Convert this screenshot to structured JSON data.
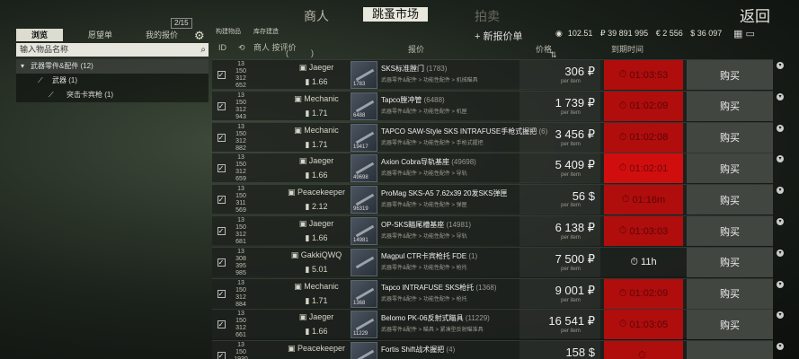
{
  "topnav": {
    "trader": "商人",
    "flea": "跳蚤市场",
    "auction": "拍卖",
    "back": "返回"
  },
  "left": {
    "tabs": {
      "browse": "浏览",
      "watch": "愿望单",
      "offers": "我的报价"
    },
    "offers_count": "2/15",
    "search_placeholder": "输入物品名称",
    "tree": [
      {
        "label": "武器零件&配件 (12)"
      },
      {
        "label": "武器 (1)"
      },
      {
        "label": "突击卡宾枪 (1)"
      }
    ]
  },
  "header": {
    "build": "构建物品",
    "stock": "库存建造",
    "seller_rating": "商人 按评价",
    "col_id": "ID",
    "col_item": "报价",
    "col_price": "价格",
    "col_expire": "到期时间",
    "paren_open": "(",
    "paren_close": ")",
    "add_offer": "+ 新报价单",
    "currencies": {
      "gp": "102.51",
      "rub": "₽ 39 891 995",
      "eur": "€ 2 556",
      "usd": "$ 36 097"
    }
  },
  "listings": [
    {
      "ids": [
        "13",
        "150",
        "312",
        "652"
      ],
      "seller": "Jaeger",
      "rating": "1.66",
      "item_id": "1783",
      "name": "SKS标准膛门",
      "count": "(1783)",
      "cat": "武器零件&配件 > 功能性配件 > 机械瞄具",
      "price": "306 ₽",
      "per": "per item",
      "timer": "01:03:53",
      "timer_style": "red",
      "buy": "购买"
    },
    {
      "ids": [
        "13",
        "150",
        "312",
        "943"
      ],
      "seller": "Mechanic",
      "rating": "1.71",
      "item_id": "6488",
      "name": "Tapco膛冲管",
      "count": "(6488)",
      "cat": "武器零件&配件 > 功能性配件 > 机匣",
      "price": "1 739 ₽",
      "per": "per item",
      "timer": "01:02:09",
      "timer_style": "red",
      "buy": "购买"
    },
    {
      "ids": [
        "13",
        "150",
        "312",
        "882"
      ],
      "seller": "Mechanic",
      "rating": "1.71",
      "item_id": "19417",
      "name": "TAPCO SAW-Style SKS INTRAFUSE手枪式握把",
      "count": "(6)",
      "cat": "武器零件&配件 > 功能性配件 > 手枪式握把",
      "price": "3 456 ₽",
      "per": "per item",
      "timer": "01:02:08",
      "timer_style": "red",
      "buy": "购买"
    },
    {
      "ids": [
        "13",
        "150",
        "312",
        "659"
      ],
      "seller": "Jaeger",
      "rating": "1.66",
      "item_id": "49698",
      "name": "Axion Cobra导轨基座",
      "count": "(49698)",
      "cat": "武器零件&配件 > 功能性配件 > 导轨",
      "price": "5 409 ₽",
      "per": "per item",
      "timer": "01:02:01",
      "timer_style": "red-bright",
      "buy": "购买"
    },
    {
      "ids": [
        "13",
        "150",
        "311",
        "569"
      ],
      "seller": "Peacekeeper",
      "rating": "2.12",
      "item_id": "96319",
      "name": "ProMag SKS-A5 7.62x39 20发SKS弹匣",
      "count": "",
      "cat": "武器零件&配件 > 功能性配件 > 弹匣",
      "price": "56 $",
      "per": "per item",
      "timer": "01:16m",
      "timer_style": "red",
      "buy": "购买"
    },
    {
      "ids": [
        "13",
        "150",
        "312",
        "681"
      ],
      "seller": "Jaeger",
      "rating": "1.66",
      "item_id": "14981",
      "name": "OP-SKS瞄尾槽基座",
      "count": "(14981)",
      "cat": "武器零件&配件 > 功能性配件 > 导轨",
      "price": "6 138 ₽",
      "per": "per item",
      "timer": "01:03:03",
      "timer_style": "red",
      "buy": "购买"
    },
    {
      "ids": [
        "13",
        "308",
        "395",
        "985"
      ],
      "seller": "GakkiQWQ",
      "rating": "5.01",
      "item_id": "",
      "name": "Magpul CTR卡宾枪托 FDE",
      "count": "(1)",
      "cat": "武器零件&配件 > 功能性配件 > 枪托",
      "price": "7 500 ₽",
      "per": "per item",
      "timer": "11h",
      "timer_style": "none",
      "buy": "购买"
    },
    {
      "ids": [
        "13",
        "150",
        "312",
        "884"
      ],
      "seller": "Mechanic",
      "rating": "1.71",
      "item_id": "1368",
      "name": "Tapco INTRAFUSE SKS枪托",
      "count": "(1368)",
      "cat": "武器零件&配件 > 功能性配件 > 枪托",
      "price": "9 001 ₽",
      "per": "per item",
      "timer": "01:02:09",
      "timer_style": "red",
      "buy": "购买"
    },
    {
      "ids": [
        "13",
        "150",
        "312",
        "661"
      ],
      "seller": "Jaeger",
      "rating": "1.66",
      "item_id": "11229",
      "name": "Belomo PK-06反射式瞄具",
      "count": "(11229)",
      "cat": "武器零件&配件 > 瞄具 > 紧凑型反射瞄准具",
      "price": "16 541 ₽",
      "per": "per item",
      "timer": "01:03:05",
      "timer_style": "red",
      "buy": "购买"
    },
    {
      "ids": [
        "13",
        "150",
        "",
        "1930"
      ],
      "seller": "Peacekeeper",
      "rating": "",
      "item_id": "18363",
      "name": "Fortis Shift战术握把",
      "count": "(4)",
      "cat": "",
      "price": "158 $",
      "per": "",
      "timer": "",
      "timer_style": "red",
      "buy": ""
    }
  ]
}
